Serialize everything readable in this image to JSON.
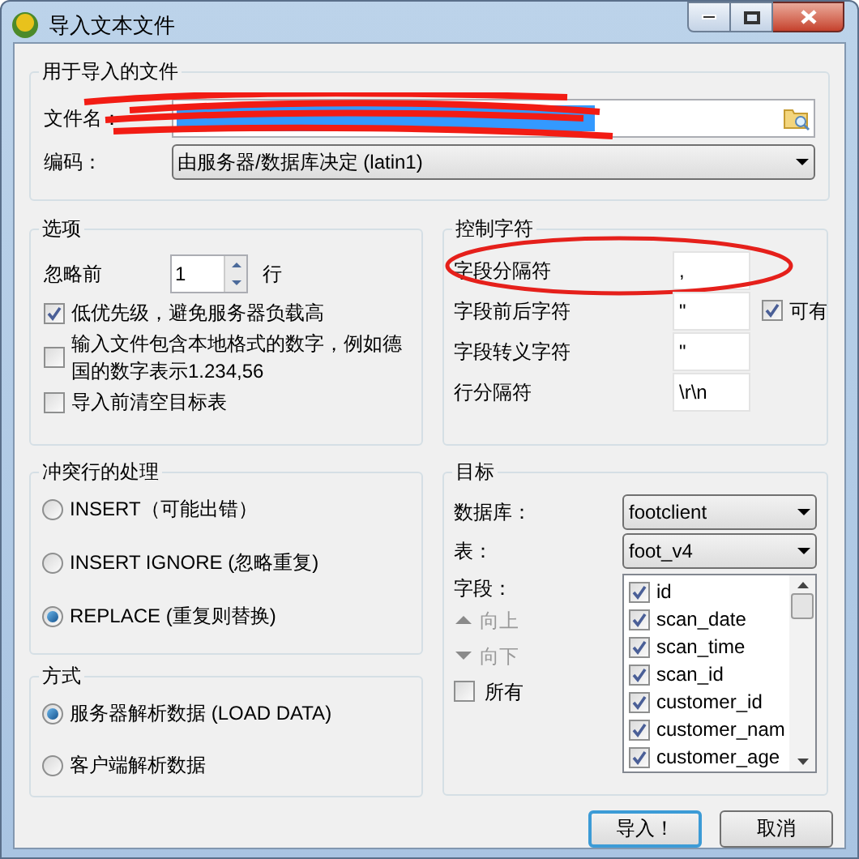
{
  "window": {
    "title": "导入文本文件"
  },
  "file_group": {
    "title": "用于导入的文件",
    "file": {
      "label": "文件名：",
      "redacted": true
    },
    "encoding": {
      "label": "编码：",
      "value": "由服务器/数据库决定 (latin1)"
    }
  },
  "options": {
    "title": "选项",
    "skip_rows": {
      "label": "忽略前",
      "value": "1",
      "suffix": "行"
    },
    "checkboxes": [
      {
        "label": "低优先级，避免服务器负载高",
        "checked": true
      },
      {
        "label": "输入文件包含本地格式的数字，例如德国的数字表示1.234,56",
        "checked": false
      },
      {
        "label": "导入前清空目标表",
        "checked": false
      }
    ]
  },
  "control_chars": {
    "title": "控制字符",
    "rows": [
      {
        "label": "字段分隔符",
        "value": ",",
        "circled": true
      },
      {
        "label": "字段前后字符",
        "value": "\"",
        "circled": false
      },
      {
        "label": "字段转义字符",
        "value": "\"",
        "circled": false
      },
      {
        "label": "行分隔符",
        "value": "\\r\\n",
        "circled": false
      }
    ],
    "optional_quote": {
      "label": "可有",
      "checked": true
    }
  },
  "conflict": {
    "title": "冲突行的处理",
    "options": [
      {
        "label": "INSERT（可能出错）",
        "selected": false
      },
      {
        "label": "INSERT IGNORE (忽略重复)",
        "selected": false
      },
      {
        "label": "REPLACE (重复则替换)",
        "selected": true
      }
    ]
  },
  "method": {
    "title": "方式",
    "options": [
      {
        "label": "服务器解析数据 (LOAD DATA)",
        "selected": true
      },
      {
        "label": "客户端解析数据",
        "selected": false
      }
    ]
  },
  "target": {
    "title": "目标",
    "database": {
      "label": "数据库：",
      "value": "footclient"
    },
    "table": {
      "label": "表：",
      "value": "foot_v4"
    },
    "fields": {
      "label": "字段：",
      "move_up": {
        "label": "向上",
        "disabled": true
      },
      "move_down": {
        "label": "向下",
        "disabled": true
      },
      "all": {
        "label": "所有",
        "checked": false
      },
      "items": [
        {
          "name": "id",
          "checked": true
        },
        {
          "name": "scan_date",
          "checked": true
        },
        {
          "name": "scan_time",
          "checked": true
        },
        {
          "name": "scan_id",
          "checked": true
        },
        {
          "name": "customer_id",
          "checked": true
        },
        {
          "name": "customer_nam",
          "checked": true
        },
        {
          "name": "customer_age",
          "checked": true
        }
      ]
    }
  },
  "buttons": [
    {
      "label": "导入！",
      "default": true
    },
    {
      "label": "取消",
      "default": false
    }
  ]
}
